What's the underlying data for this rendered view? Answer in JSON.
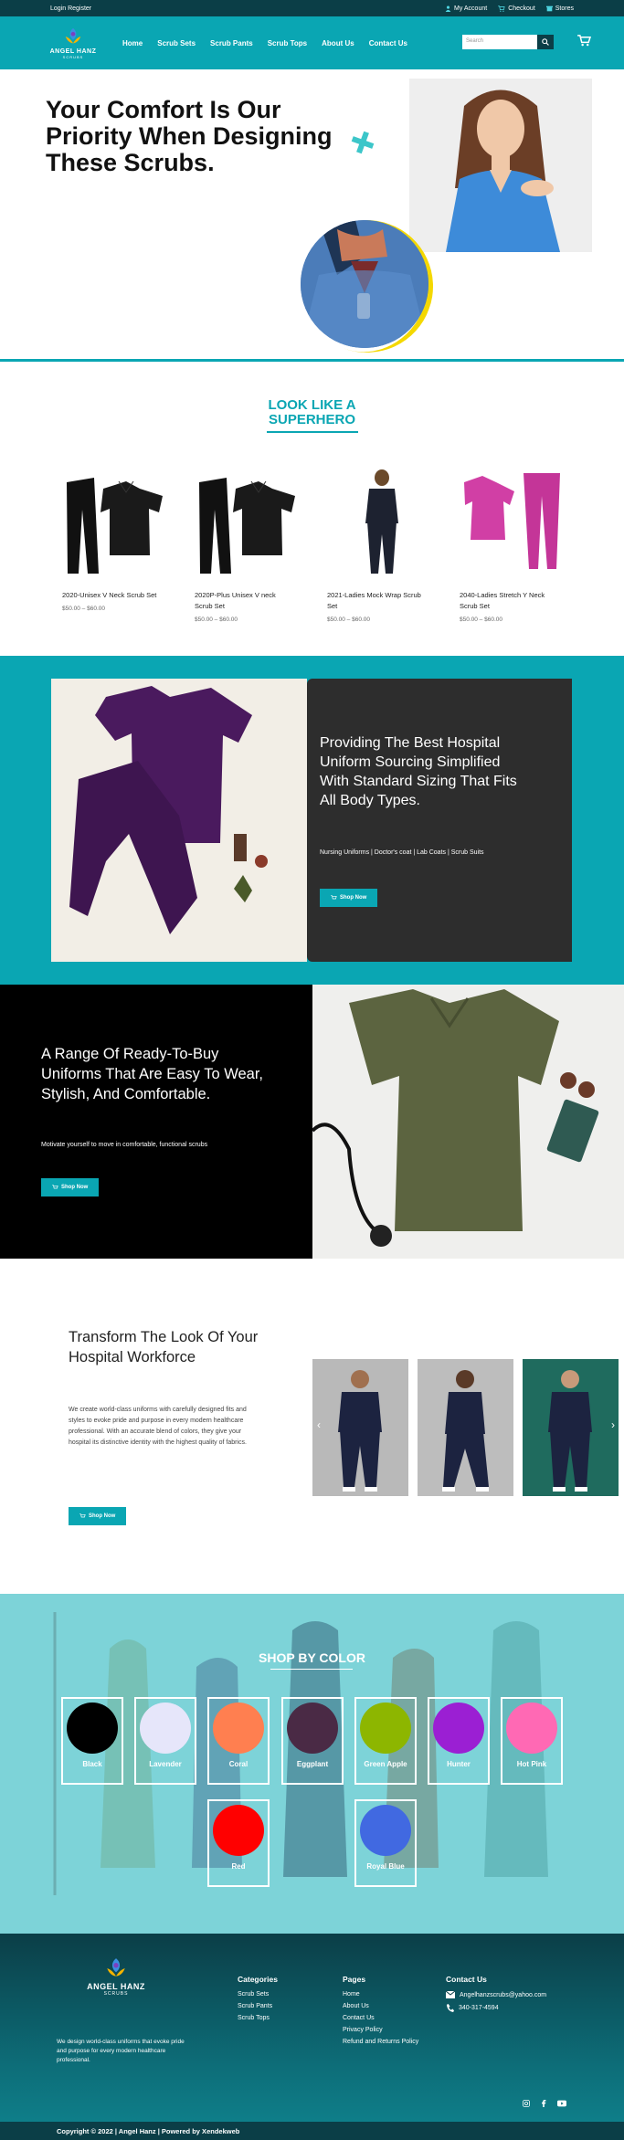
{
  "topbar": {
    "login": "Login Register",
    "account": "My Account",
    "checkout": "Checkout",
    "stores": "Stores"
  },
  "header": {
    "logo_name": "ANGEL HANZ",
    "logo_sub": "SCRUBS",
    "nav": [
      "Home",
      "Scrub Sets",
      "Scrub Pants",
      "Scrub Tops",
      "About Us",
      "Contact Us"
    ],
    "search_placeholder": "Search"
  },
  "hero": {
    "heading": "Your Comfort Is Our Priority When Designing These Scrubs."
  },
  "products": {
    "heading_line1": "LOOK LIKE A",
    "heading_line2": "SUPERHERO",
    "items": [
      {
        "title": "2020-Unisex V Neck Scrub Set",
        "price": "$50.00 – $60.00"
      },
      {
        "title": "2020P-Plus Unisex V neck Scrub Set",
        "price": "$50.00 – $60.00"
      },
      {
        "title": "2021-Ladies Mock Wrap Scrub Set",
        "price": "$50.00 – $60.00"
      },
      {
        "title": "2040-Ladies Stretch Y Neck Scrub Set",
        "price": "$50.00 – $60.00"
      }
    ]
  },
  "promo1": {
    "heading": "Providing The Best Hospital Uniform Sourcing Simplified With Standard Sizing That Fits All Body Types.",
    "sub": "Nursing Uniforms | Doctor's coat | Lab Coats | Scrub Suits",
    "button": "Shop Now"
  },
  "promo2": {
    "heading": "A Range Of Ready-To-Buy Uniforms That Are Easy To Wear, Stylish, And Comfortable.",
    "sub": "Motivate yourself to move in comfortable, functional scrubs",
    "button": "Shop Now"
  },
  "transform": {
    "heading": "Transform The Look Of Your Hospital Workforce",
    "body": "We create world-class uniforms with carefully designed fits and styles to evoke pride and purpose in every modern healthcare professional. With an accurate blend of colors, they give your hospital its distinctive identity with the highest quality of fabrics.",
    "button": "Shop Now"
  },
  "shop_by_color": {
    "heading": "SHOP BY COLOR",
    "colors": [
      {
        "name": "Black",
        "hex": "#000000"
      },
      {
        "name": "Lavender",
        "hex": "#e6e6fa"
      },
      {
        "name": "Coral",
        "hex": "#ff7f50"
      },
      {
        "name": "Eggplant",
        "hex": "#4a2a45"
      },
      {
        "name": "Green Apple",
        "hex": "#8db600"
      },
      {
        "name": "Hunter",
        "hex": "#9b1fd3"
      },
      {
        "name": "Hot Pink",
        "hex": "#ff69b4"
      },
      {
        "name": "Red",
        "hex": "#ff0000"
      },
      {
        "name": "Royal Blue",
        "hex": "#4169e1"
      }
    ]
  },
  "footer": {
    "logo_name": "ANGEL HANZ",
    "logo_sub": "SCRUBS",
    "description": "We design world-class uniforms that evoke pride and purpose for every modern healthcare professional.",
    "categories_title": "Categories",
    "categories": [
      "Scrub Sets",
      "Scrub Pants",
      "Scrub Tops"
    ],
    "pages_title": "Pages",
    "pages": [
      "Home",
      "About Us",
      "Contact Us",
      "Privacy Policy",
      "Refund and Returns Policy"
    ],
    "contact_title": "Contact Us",
    "email": "Angelhanzscrubs@yahoo.com",
    "phone": "340-317-4594",
    "copyright": "Copyright © 2022 | Angel Hanz | Powered by Xendekweb"
  },
  "colors": {
    "teal": "#0aa6b3",
    "dark": "#0b3e47",
    "yellow": "#f4d800"
  }
}
